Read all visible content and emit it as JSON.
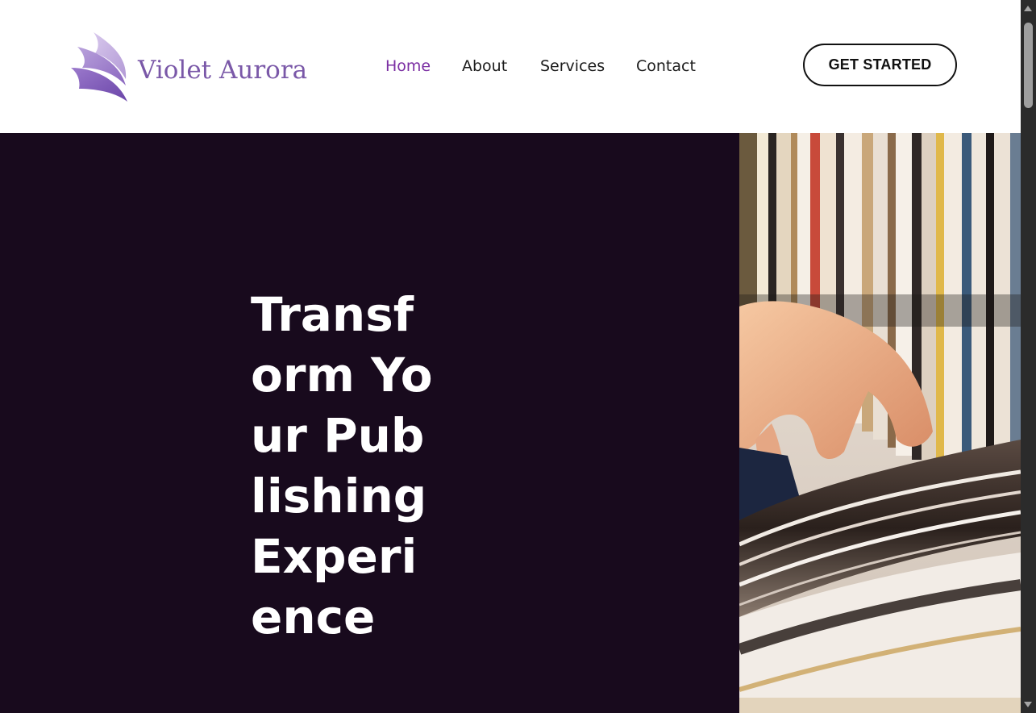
{
  "brand": {
    "name": "Violet Aurora",
    "color": "#7a58a8"
  },
  "nav": {
    "items": [
      {
        "label": "Home",
        "active": true
      },
      {
        "label": "About",
        "active": false
      },
      {
        "label": "Services",
        "active": false
      },
      {
        "label": "Contact",
        "active": false
      }
    ],
    "active_color": "#7b2fa3"
  },
  "header": {
    "cta_label": "GET STARTED"
  },
  "hero": {
    "title": "Transform Your Publishing Experience",
    "background_color": "#180a1d",
    "image_subject": "hand-flipping-magazine-pages"
  }
}
